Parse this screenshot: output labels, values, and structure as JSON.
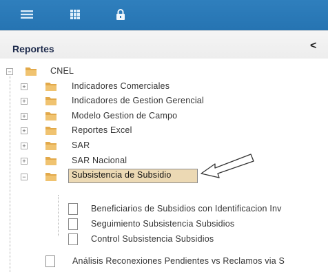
{
  "toolbar": {
    "buttons": [
      {
        "icon": "menu-icon"
      },
      {
        "icon": "grid-icon"
      },
      {
        "icon": "lock-icon"
      }
    ]
  },
  "panel": {
    "title": "Reportes",
    "collapse_glyph": "<"
  },
  "tree": {
    "root": "CNEL",
    "folders": [
      "Indicadores Comerciales",
      "Indicadores de Gestion Gerencial",
      "Modelo Gestion de Campo",
      "Reportes Excel",
      "SAR",
      "SAR Nacional",
      "Subsistencia de Subsidio"
    ],
    "subsidio_children": [
      "Beneficiarios de Subsidios con Identificacion Inv",
      "Seguimiento Subsistencia Subsidios",
      "Control Subsistencia Subsidios"
    ],
    "root_leaf": "Análisis Reconexiones Pendientes vs Reclamos via S"
  },
  "colors": {
    "toolbar": "#2a78b6",
    "selected": "#ecd9b4",
    "folder": "#e2a94a"
  }
}
